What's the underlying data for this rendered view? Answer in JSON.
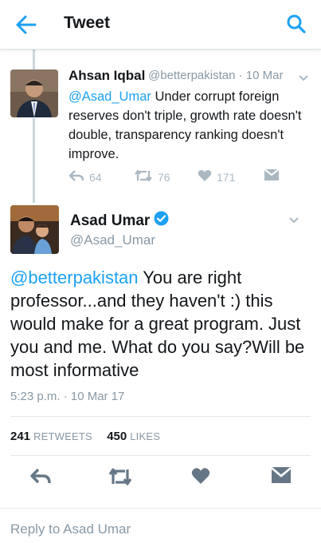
{
  "header": {
    "title": "Tweet",
    "back_icon": "arrow-left-icon",
    "search_icon": "search-icon",
    "accent": "#1da1f2"
  },
  "parent_tweet": {
    "name": "Ahsan Iqbal",
    "meta": "@betterpakistan · 10 Mar",
    "mention": "@Asad_Umar",
    "text": " Under corrupt foreign reserves don't triple, growth rate doesn't double, transparency ranking doesn't improve.",
    "reply_count": "64",
    "retweet_count": "76",
    "like_count": "171"
  },
  "main_tweet": {
    "name": "Asad Umar",
    "handle": "@Asad_Umar",
    "verified": true,
    "mention": "@betterpakistan",
    "text": " You are right professor...and they haven't :) this would make for a great program. Just you and me. What do you say?Will be most informative",
    "timestamp": "5:23 p.m. · 10 Mar 17",
    "retweets": "241",
    "retweets_label": "RETWEETS",
    "likes": "450",
    "likes_label": "LIKES"
  },
  "reply_bar": {
    "placeholder": "Reply to Asad Umar"
  }
}
